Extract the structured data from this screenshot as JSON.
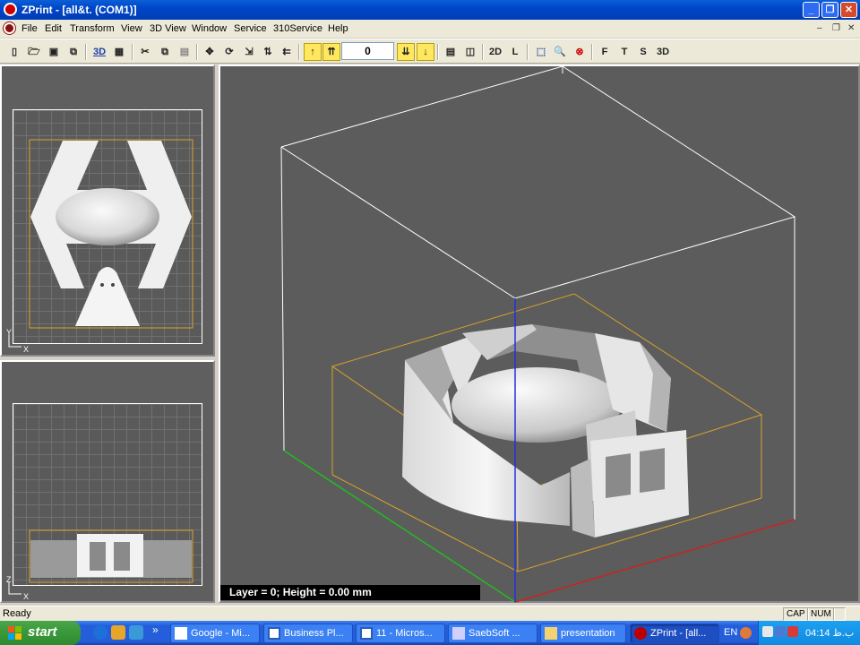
{
  "window": {
    "title": "ZPrint - [all&t. (COM1)]"
  },
  "menu": [
    "File",
    "Edit",
    "Transform",
    "View",
    "3D View",
    "Window",
    "Service",
    "310Service",
    "Help"
  ],
  "toolbar": {
    "layer_value": "0",
    "icons": [
      "new-icon",
      "open-icon",
      "save-icon",
      "export-icon",
      "3d-print-icon",
      "setup-icon",
      "cut-icon",
      "copy-icon",
      "paste-icon",
      "move-icon",
      "rotate-icon",
      "scale-icon",
      "mirror-icon",
      "align-icon",
      "layer-up-icon",
      "layer-top-icon",
      "layer-down-icon",
      "layer-bottom-icon",
      "report-icon",
      "box-icon",
      "view-2d",
      "view-l",
      "cube-icon",
      "zoom-icon",
      "reset-icon",
      "view-f",
      "view-t",
      "view-s",
      "view-3d"
    ],
    "text_buttons": {
      "b3d": "3D",
      "v2d": "2D",
      "vl": "L",
      "vf": "F",
      "vt": "T",
      "vs": "S",
      "v3d": "3D"
    }
  },
  "viewport": {
    "overlay": "Layer = 0; Height = 0.00 mm",
    "top_axis_y": "Y",
    "top_axis_x": "X",
    "front_axis_z": "Z",
    "front_axis_x": "X"
  },
  "statusbar": {
    "ready": "Ready",
    "cap": "CAP",
    "num": "NUM"
  },
  "taskbar": {
    "start": "start",
    "tasks": [
      {
        "label": "Google - Mi...",
        "icon": "browser-icon"
      },
      {
        "label": "Business Pl...",
        "icon": "word-icon"
      },
      {
        "label": "11 - Micros...",
        "icon": "word-icon"
      },
      {
        "label": "SaebSoft ...",
        "icon": "app-icon"
      },
      {
        "label": "presentation",
        "icon": "folder-icon"
      },
      {
        "label": "ZPrint - [all...",
        "icon": "zprint-icon"
      }
    ],
    "lang": "EN",
    "clock": "04:14 ب.ظ",
    "chevron": "»"
  }
}
